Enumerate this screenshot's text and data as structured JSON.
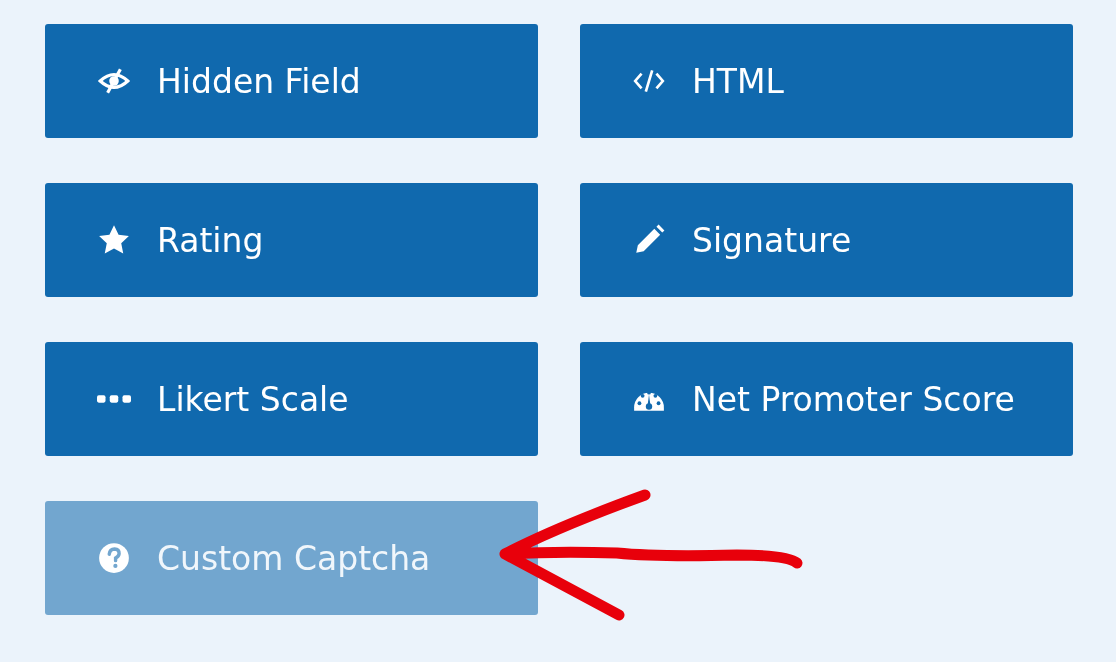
{
  "fields": [
    {
      "label": "Hidden Field",
      "disabled": false
    },
    {
      "label": "HTML",
      "disabled": false
    },
    {
      "label": "Rating",
      "disabled": false
    },
    {
      "label": "Signature",
      "disabled": false
    },
    {
      "label": "Likert Scale",
      "disabled": false
    },
    {
      "label": "Net Promoter Score",
      "disabled": false
    },
    {
      "label": "Custom Captcha",
      "disabled": true
    }
  ]
}
